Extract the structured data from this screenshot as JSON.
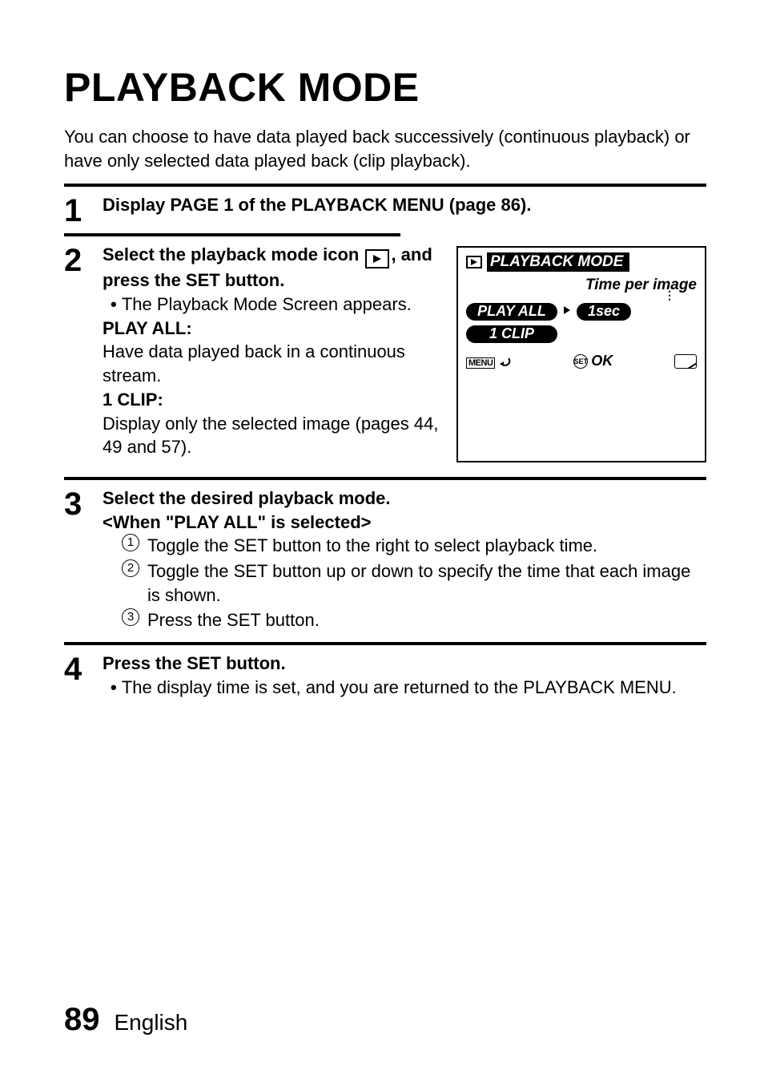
{
  "title": "PLAYBACK MODE",
  "intro": "You can choose to have data played back successively (continuous playback) or have only selected data played back (clip playback).",
  "steps": {
    "s1": {
      "num": "1",
      "text": "Display PAGE 1 of the PLAYBACK MENU (page 86)."
    },
    "s2": {
      "num": "2",
      "lead_a": "Select the playback mode icon ",
      "lead_b": ", and press the SET button.",
      "bullet": "The Playback Mode Screen appears.",
      "playall_label": "PLAY ALL:",
      "playall_text": "Have data played back in a continuous stream.",
      "oneclip_label": "1 CLIP:",
      "oneclip_text": "Display only the selected image (pages 44, 49 and 57)."
    },
    "s3": {
      "num": "3",
      "lead": "Select the desired playback mode.",
      "sub": "<When \"PLAY ALL\" is selected>",
      "items": [
        "Toggle the SET button to the right to select playback time.",
        "Toggle the SET button up or down to specify the time that each image is shown.",
        "Press the SET button."
      ],
      "nums": [
        "1",
        "2",
        "3"
      ]
    },
    "s4": {
      "num": "4",
      "lead": "Press the SET button.",
      "bullet": "The display time is set, and you are returned to the PLAYBACK MENU."
    }
  },
  "osd": {
    "title": "PLAYBACK MODE",
    "time_label": "Time per image",
    "play_all": "PLAY ALL",
    "time_value": "1sec",
    "one_clip": "1 CLIP",
    "menu_label": "MENU",
    "set_label": "SET",
    "ok_label": "OK"
  },
  "footer": {
    "page": "89",
    "lang": "English"
  }
}
